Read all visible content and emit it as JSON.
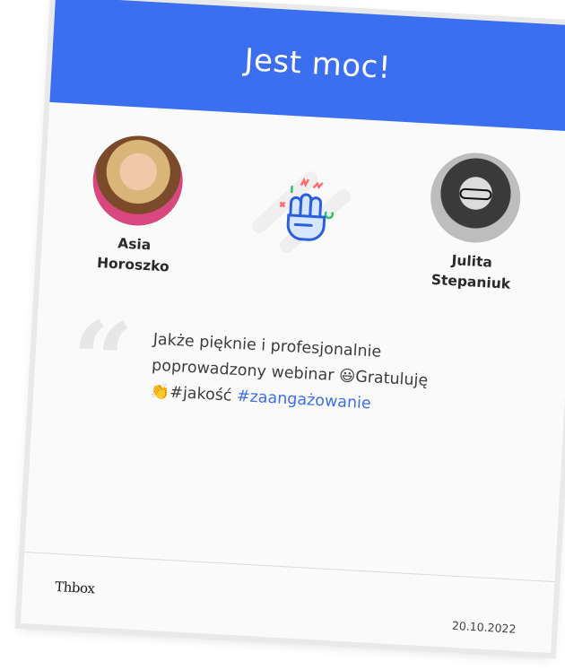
{
  "card": {
    "header_title": "Jest moc!",
    "header_color": "#3c6ff0",
    "sender": {
      "first_name": "Asia",
      "last_name": "Horoszko"
    },
    "recipient": {
      "first_name": "Julita",
      "last_name": "Stepaniuk"
    },
    "center_icon": "raised-fist-icon",
    "quote": {
      "line1": "Jakże pięknie i profesjonalnie",
      "line2": "poprowadzony webinar",
      "emoji1": "😃",
      "word_after_emoji": "Gratuluję",
      "emoji2": "👏",
      "hashtag1": "#jakość",
      "hashtag2": "#zaangażowanie"
    },
    "logo": "Thbox",
    "date": "20.10.2022"
  }
}
